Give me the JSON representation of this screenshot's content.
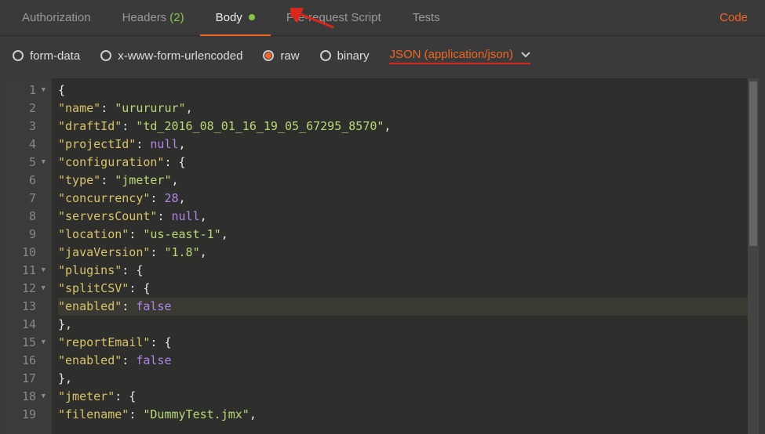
{
  "tabs": {
    "authorization": "Authorization",
    "headers": "Headers",
    "headers_count": "(2)",
    "body": "Body",
    "prerequest": "Pre-request Script",
    "tests": "Tests",
    "code": "Code"
  },
  "body_options": {
    "form_data": "form-data",
    "urlencoded": "x-www-form-urlencoded",
    "raw": "raw",
    "binary": "binary",
    "content_type": "JSON (application/json)"
  },
  "code_lines": [
    {
      "n": "1",
      "fold": true,
      "tokens": [
        [
          "p",
          "{"
        ]
      ]
    },
    {
      "n": "2",
      "tokens": [
        [
          "k",
          "\"name\""
        ],
        [
          "p",
          ": "
        ],
        [
          "s",
          "\"urururur\""
        ],
        [
          "p",
          ","
        ]
      ]
    },
    {
      "n": "3",
      "tokens": [
        [
          "k",
          "\"draftId\""
        ],
        [
          "p",
          ": "
        ],
        [
          "s",
          "\"td_2016_08_01_16_19_05_67295_8570\""
        ],
        [
          "p",
          ","
        ]
      ]
    },
    {
      "n": "4",
      "tokens": [
        [
          "k",
          "\"projectId\""
        ],
        [
          "p",
          ": "
        ],
        [
          "n",
          "null"
        ],
        [
          "p",
          ","
        ]
      ]
    },
    {
      "n": "5",
      "fold": true,
      "tokens": [
        [
          "k",
          "\"configuration\""
        ],
        [
          "p",
          ": {"
        ]
      ]
    },
    {
      "n": "6",
      "tokens": [
        [
          "k",
          "\"type\""
        ],
        [
          "p",
          ": "
        ],
        [
          "s",
          "\"jmeter\""
        ],
        [
          "p",
          ","
        ]
      ]
    },
    {
      "n": "7",
      "tokens": [
        [
          "k",
          "\"concurrency\""
        ],
        [
          "p",
          ": "
        ],
        [
          "n",
          "28"
        ],
        [
          "p",
          ","
        ]
      ]
    },
    {
      "n": "8",
      "tokens": [
        [
          "k",
          "\"serversCount\""
        ],
        [
          "p",
          ": "
        ],
        [
          "n",
          "null"
        ],
        [
          "p",
          ","
        ]
      ]
    },
    {
      "n": "9",
      "tokens": [
        [
          "k",
          "\"location\""
        ],
        [
          "p",
          ": "
        ],
        [
          "s",
          "\"us-east-1\""
        ],
        [
          "p",
          ","
        ]
      ]
    },
    {
      "n": "10",
      "tokens": [
        [
          "k",
          "\"javaVersion\""
        ],
        [
          "p",
          ": "
        ],
        [
          "s",
          "\"1.8\""
        ],
        [
          "p",
          ","
        ]
      ]
    },
    {
      "n": "11",
      "fold": true,
      "tokens": [
        [
          "k",
          "\"plugins\""
        ],
        [
          "p",
          ": {"
        ]
      ]
    },
    {
      "n": "12",
      "fold": true,
      "tokens": [
        [
          "k",
          "\"splitCSV\""
        ],
        [
          "p",
          ": {"
        ]
      ]
    },
    {
      "n": "13",
      "hl": true,
      "tokens": [
        [
          "k",
          "\"enabled\""
        ],
        [
          "p",
          ": "
        ],
        [
          "n",
          "false"
        ]
      ]
    },
    {
      "n": "14",
      "tokens": [
        [
          "p",
          "},"
        ]
      ]
    },
    {
      "n": "15",
      "fold": true,
      "tokens": [
        [
          "k",
          "\"reportEmail\""
        ],
        [
          "p",
          ": {"
        ]
      ]
    },
    {
      "n": "16",
      "tokens": [
        [
          "k",
          "\"enabled\""
        ],
        [
          "p",
          ": "
        ],
        [
          "n",
          "false"
        ]
      ]
    },
    {
      "n": "17",
      "tokens": [
        [
          "p",
          "},"
        ]
      ]
    },
    {
      "n": "18",
      "fold": true,
      "tokens": [
        [
          "k",
          "\"jmeter\""
        ],
        [
          "p",
          ": {"
        ]
      ]
    },
    {
      "n": "19",
      "tokens": [
        [
          "k",
          "\"filename\""
        ],
        [
          "p",
          ": "
        ],
        [
          "s",
          "\"DummyTest.jmx\""
        ],
        [
          "p",
          ","
        ]
      ]
    }
  ]
}
